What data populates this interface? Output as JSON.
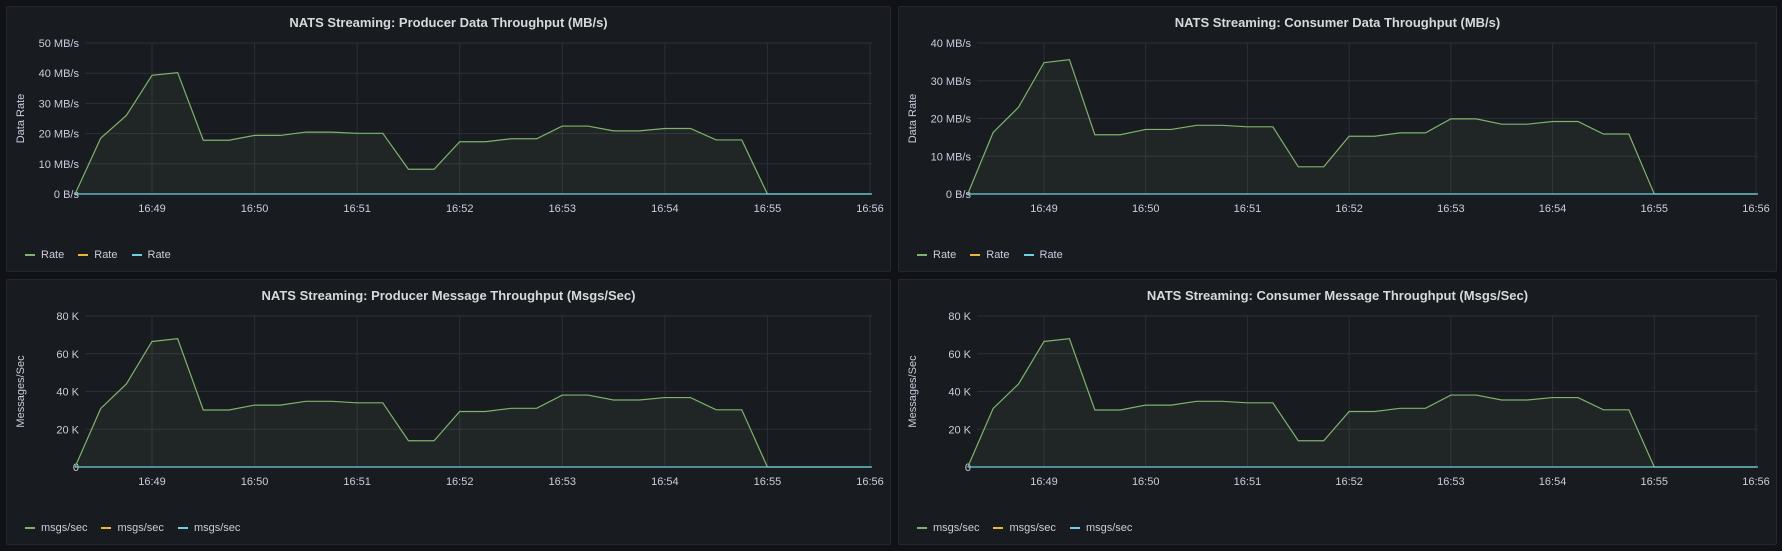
{
  "colors": {
    "series0": "#7eb26d",
    "series1": "#eab839",
    "series2": "#6ed0e0",
    "grid": "#2c3036",
    "fill": "rgba(126,178,109,0.08)"
  },
  "panels": [
    {
      "title": "NATS Streaming: Producer Data Throughput (MB/s)",
      "ylabel": "Data Rate",
      "legend": [
        "Rate",
        "Rate",
        "Rate"
      ],
      "chart_data": {
        "type": "area",
        "title": "NATS Streaming: Producer Data Throughput (MB/s)",
        "ylabel": "Data Rate",
        "x_ticks": [
          "16:49",
          "16:50",
          "16:51",
          "16:52",
          "16:53",
          "16:54",
          "16:55",
          "16:56"
        ],
        "y_ticks": [
          "0 B/s",
          "10 MB/s",
          "20 MB/s",
          "30 MB/s",
          "40 MB/s",
          "50 MB/s"
        ],
        "ylim": [
          0,
          50
        ],
        "unit": "MB/s",
        "series": [
          {
            "name": "Rate",
            "x": [
              "16:48:15",
              "16:48:30",
              "16:48:45",
              "16:49:00",
              "16:49:15",
              "16:49:30",
              "16:49:45",
              "16:50:00",
              "16:50:15",
              "16:50:30",
              "16:50:45",
              "16:51:00",
              "16:51:15",
              "16:51:30",
              "16:51:45",
              "16:52:00",
              "16:52:15",
              "16:52:30",
              "16:52:45",
              "16:53:00",
              "16:53:15",
              "16:53:30",
              "16:53:45",
              "16:54:00",
              "16:54:15",
              "16:54:30",
              "16:54:45",
              "16:55:00",
              "16:56:00"
            ],
            "values": [
              0,
              18.5,
              26,
              39.3,
              40.2,
              17.8,
              17.8,
              19.4,
              19.4,
              20.5,
              20.5,
              20.1,
              20.1,
              8.2,
              8.2,
              17.3,
              17.3,
              18.3,
              18.3,
              22.5,
              22.5,
              20.9,
              20.9,
              21.7,
              21.7,
              17.9,
              17.9,
              0,
              0
            ]
          },
          {
            "name": "Rate",
            "values_constant": 0
          },
          {
            "name": "Rate",
            "values_constant": 0
          }
        ]
      }
    },
    {
      "title": "NATS Streaming: Consumer Data Throughput (MB/s)",
      "ylabel": "Data Rate",
      "legend": [
        "Rate",
        "Rate",
        "Rate"
      ],
      "chart_data": {
        "type": "area",
        "title": "NATS Streaming: Consumer Data Throughput (MB/s)",
        "ylabel": "Data Rate",
        "x_ticks": [
          "16:49",
          "16:50",
          "16:51",
          "16:52",
          "16:53",
          "16:54",
          "16:55",
          "16:56"
        ],
        "y_ticks": [
          "0 B/s",
          "10 MB/s",
          "20 MB/s",
          "30 MB/s",
          "40 MB/s"
        ],
        "ylim": [
          0,
          40
        ],
        "unit": "MB/s",
        "series": [
          {
            "name": "Rate",
            "x": [
              "16:48:15",
              "16:48:30",
              "16:48:45",
              "16:49:00",
              "16:49:15",
              "16:49:30",
              "16:49:45",
              "16:50:00",
              "16:50:15",
              "16:50:30",
              "16:50:45",
              "16:51:00",
              "16:51:15",
              "16:51:30",
              "16:51:45",
              "16:52:00",
              "16:52:15",
              "16:52:30",
              "16:52:45",
              "16:53:00",
              "16:53:15",
              "16:53:30",
              "16:53:45",
              "16:54:00",
              "16:54:15",
              "16:54:30",
              "16:54:45",
              "16:55:00",
              "16:56:00"
            ],
            "values": [
              0,
              16.3,
              23,
              34.8,
              35.6,
              15.7,
              15.7,
              17.1,
              17.1,
              18.2,
              18.2,
              17.8,
              17.8,
              7.2,
              7.2,
              15.3,
              15.3,
              16.2,
              16.2,
              19.9,
              19.9,
              18.5,
              18.5,
              19.2,
              19.2,
              15.9,
              15.9,
              0,
              0
            ]
          },
          {
            "name": "Rate",
            "values_constant": 0
          },
          {
            "name": "Rate",
            "values_constant": 0
          }
        ]
      }
    },
    {
      "title": "NATS Streaming: Producer Message Throughput (Msgs/Sec)",
      "ylabel": "Messages/Sec",
      "legend": [
        "msgs/sec",
        "msgs/sec",
        "msgs/sec"
      ],
      "chart_data": {
        "type": "area",
        "title": "NATS Streaming: Producer Message Throughput (Msgs/Sec)",
        "ylabel": "Messages/Sec",
        "x_ticks": [
          "16:49",
          "16:50",
          "16:51",
          "16:52",
          "16:53",
          "16:54",
          "16:55",
          "16:56"
        ],
        "y_ticks": [
          "0",
          "20 K",
          "40 K",
          "60 K",
          "80 K"
        ],
        "ylim": [
          0,
          80000
        ],
        "series": [
          {
            "name": "msgs/sec",
            "x": [
              "16:48:15",
              "16:48:30",
              "16:48:45",
              "16:49:00",
              "16:49:15",
              "16:49:30",
              "16:49:45",
              "16:50:00",
              "16:50:15",
              "16:50:30",
              "16:50:45",
              "16:51:00",
              "16:51:15",
              "16:51:30",
              "16:51:45",
              "16:52:00",
              "16:52:15",
              "16:52:30",
              "16:52:45",
              "16:53:00",
              "16:53:15",
              "16:53:30",
              "16:53:45",
              "16:54:00",
              "16:54:15",
              "16:54:30",
              "16:54:45",
              "16:55:00",
              "16:56:00"
            ],
            "values": [
              0,
              31000,
              44000,
              66500,
              68000,
              30200,
              30200,
              32800,
              32800,
              34800,
              34800,
              34000,
              34000,
              13900,
              13900,
              29400,
              29400,
              31100,
              31100,
              38100,
              38100,
              35500,
              35500,
              36800,
              36800,
              30300,
              30300,
              0,
              0
            ]
          },
          {
            "name": "msgs/sec",
            "values_constant": 0
          },
          {
            "name": "msgs/sec",
            "values_constant": 0
          }
        ]
      }
    },
    {
      "title": "NATS Streaming: Consumer Message Throughput (Msgs/Sec)",
      "ylabel": "Messages/Sec",
      "legend": [
        "msgs/sec",
        "msgs/sec",
        "msgs/sec"
      ],
      "chart_data": {
        "type": "area",
        "title": "NATS Streaming: Consumer Message Throughput (Msgs/Sec)",
        "ylabel": "Messages/Sec",
        "x_ticks": [
          "16:49",
          "16:50",
          "16:51",
          "16:52",
          "16:53",
          "16:54",
          "16:55",
          "16:56"
        ],
        "y_ticks": [
          "0",
          "20 K",
          "40 K",
          "60 K",
          "80 K"
        ],
        "ylim": [
          0,
          80000
        ],
        "series": [
          {
            "name": "msgs/sec",
            "x": [
              "16:48:15",
              "16:48:30",
              "16:48:45",
              "16:49:00",
              "16:49:15",
              "16:49:30",
              "16:49:45",
              "16:50:00",
              "16:50:15",
              "16:50:30",
              "16:50:45",
              "16:51:00",
              "16:51:15",
              "16:51:30",
              "16:51:45",
              "16:52:00",
              "16:52:15",
              "16:52:30",
              "16:52:45",
              "16:53:00",
              "16:53:15",
              "16:53:30",
              "16:53:45",
              "16:54:00",
              "16:54:15",
              "16:54:30",
              "16:54:45",
              "16:55:00",
              "16:56:00"
            ],
            "values": [
              0,
              31000,
              44000,
              66500,
              68000,
              30200,
              30200,
              32800,
              32800,
              34800,
              34800,
              34000,
              34000,
              13900,
              13900,
              29400,
              29400,
              31100,
              31100,
              38100,
              38100,
              35500,
              35500,
              36800,
              36800,
              30300,
              30300,
              0,
              0
            ]
          },
          {
            "name": "msgs/sec",
            "values_constant": 0
          },
          {
            "name": "msgs/sec",
            "values_constant": 0
          }
        ]
      }
    }
  ]
}
